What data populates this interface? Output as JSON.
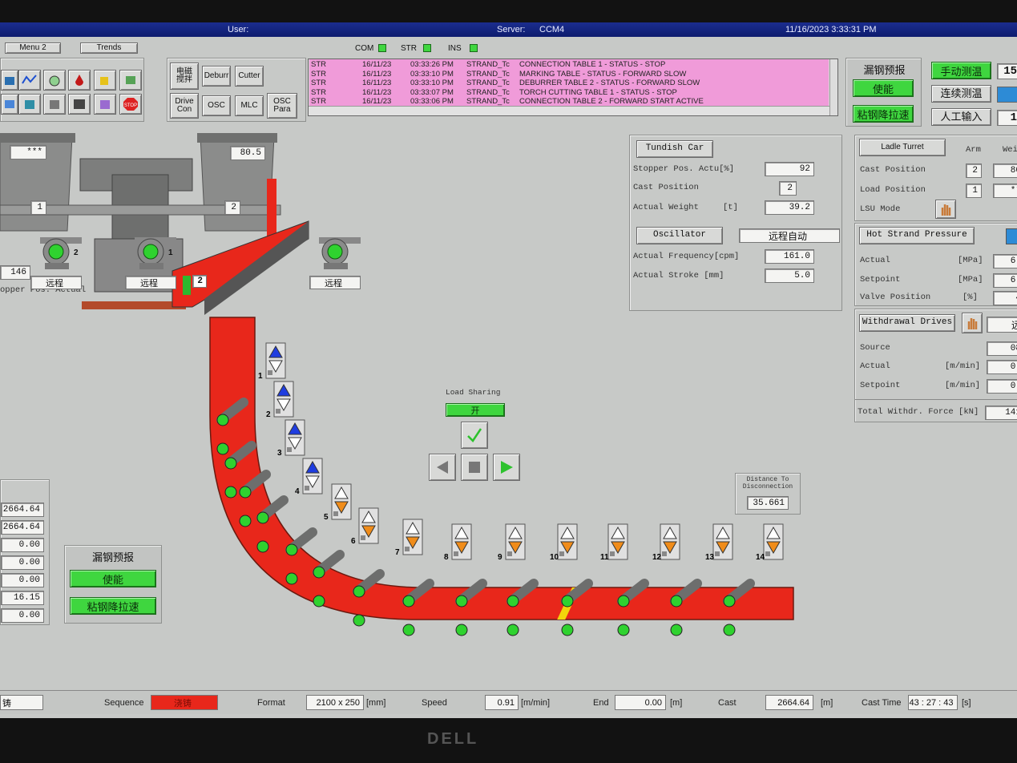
{
  "titlebar": {
    "user_label": "User:",
    "server_label": "Server:",
    "server_value": "CCM4",
    "datetime": "11/16/2023 3:33:31 PM"
  },
  "topnav": {
    "menu2": "Menu 2",
    "trends": "Trends"
  },
  "comm": {
    "com": "COM",
    "str": "STR",
    "ins": "INS"
  },
  "tool_buttons": {
    "em_stir": "电磁\n搅拌",
    "deburr": "Deburr",
    "cutter": "Cutter",
    "drive_con": "Drive\nCon",
    "osc": "OSC",
    "mlc": "MLC",
    "osc_para": "OSC\nPara"
  },
  "alarms": [
    {
      "src": "STR",
      "date": "16/11/23",
      "time": "03:33:26 PM",
      "tag": "STRAND_Tc",
      "msg": "CONNECTION TABLE 1 - STATUS - STOP"
    },
    {
      "src": "STR",
      "date": "16/11/23",
      "time": "03:33:10 PM",
      "tag": "STRAND_Tc",
      "msg": "MARKING TABLE - STATUS - FORWARD SLOW"
    },
    {
      "src": "STR",
      "date": "16/11/23",
      "time": "03:33:10 PM",
      "tag": "STRAND_Tc",
      "msg": "DEBURRER TABLE 2 - STATUS - FORWARD SLOW"
    },
    {
      "src": "STR",
      "date": "16/11/23",
      "time": "03:33:07 PM",
      "tag": "STRAND_Tc",
      "msg": "TORCH CUTTING TABLE 1 - STATUS - STOP"
    },
    {
      "src": "STR",
      "date": "16/11/23",
      "time": "03:33:06 PM",
      "tag": "STRAND_Tc",
      "msg": "CONNECTION TABLE 2 - FORWARD START ACTIVE"
    }
  ],
  "breakout_top": {
    "title": "漏钢预报",
    "enable": "使能",
    "slowdown": "粘钢降拉速"
  },
  "temp_buttons": {
    "manual": "手动测温",
    "continuous": "连续测温",
    "manual_input": "人工输入",
    "v1": "15",
    "v3": "1"
  },
  "ladle": {
    "left_value": "***",
    "right_value": "80.5",
    "left_arm": "1",
    "right_arm": "2",
    "tundish_num": "2",
    "stopper_value": "146",
    "stopper_label": "opper Pos. Actual"
  },
  "fans": [
    {
      "num": "2",
      "label": "远程"
    },
    {
      "num": "1",
      "label": "远程"
    },
    {
      "num": "",
      "label": "远程"
    }
  ],
  "tundish_car": {
    "title": "Tundish Car",
    "stopper_label": "Stopper Pos. Actu",
    "stopper_unit": "[%]",
    "stopper_value": "92",
    "cast_pos_label": "Cast Position",
    "cast_pos_value": "2",
    "weight_label": "Actual Weight",
    "weight_unit": "[t]",
    "weight_value": "39.2"
  },
  "oscillator": {
    "title": "Oscillator",
    "mode": "远程自动",
    "freq_label": "Actual Frequency",
    "freq_unit": "[cpm]",
    "freq_value": "161.0",
    "stroke_label": "Actual Stroke",
    "stroke_unit": "[mm]",
    "stroke_value": "5.0"
  },
  "ladle_turret": {
    "title": "Ladle Turret",
    "arm_hdr": "Arm",
    "weight_hdr": "Wei",
    "cast_pos_label": "Cast Position",
    "cast_pos_arm": "2",
    "cast_pos_val": "80",
    "load_pos_label": "Load Position",
    "load_pos_arm": "1",
    "load_pos_val": "**",
    "lsu_label": "LSU Mode"
  },
  "hot_strand": {
    "title": "Hot Strand Pressure",
    "actual_label": "Actual",
    "actual_unit": "[MPa]",
    "actual_val": "6.",
    "setpoint_label": "Setpoint",
    "setpoint_unit": "[MPa]",
    "setpoint_val": "6.",
    "valve_label": "Valve Position",
    "valve_unit": "[%]",
    "valve_val": "4"
  },
  "withdrawal": {
    "title": "Withdrawal Drives",
    "mode_val": "远",
    "source_label": "Source",
    "source_val": "08",
    "actual_label": "Actual",
    "actual_unit": "[m/min]",
    "actual_val": "0.",
    "setpoint_label": "Setpoint",
    "setpoint_unit": "[m/min]",
    "setpoint_val": "0.",
    "force_label": "Total Withdr. Force",
    "force_unit": "[kN]",
    "force_val": "141"
  },
  "load_sharing": {
    "title": "Load Sharing",
    "state": "开"
  },
  "distance": {
    "title": "Distance To Disconnection",
    "value": "35.661"
  },
  "segments": [
    "1",
    "2",
    "3",
    "4",
    "5",
    "6",
    "7",
    "8",
    "9",
    "10",
    "11",
    "12",
    "13",
    "14"
  ],
  "left_values": [
    "2664.64",
    "2664.64",
    "0.00",
    "0.00",
    "0.00",
    "16.15",
    "0.00"
  ],
  "breakout_bottom": {
    "title": "漏钢预报",
    "enable": "使能",
    "slowdown": "粘钢降拉速"
  },
  "statusbar": {
    "left": "铸",
    "sequence_label": "Sequence",
    "sequence_value": "浇铸",
    "format_label": "Format",
    "format_value": "2100 x 250",
    "format_unit": "[mm]",
    "speed_label": "Speed",
    "speed_value": "0.91",
    "speed_unit": "[m/min]",
    "end_label": "End",
    "end_value": "0.00",
    "end_unit": "[m]",
    "cast_label": "Cast",
    "cast_value": "2664.64",
    "cast_unit": "[m]",
    "casttime_label": "Cast Time",
    "casttime_value": "43 : 27 : 43",
    "casttime_unit": "[s]"
  },
  "bezel_logo": "DELL",
  "colors": {
    "titlebar": "#1b2d8f",
    "alarm_row": "#f09bd9",
    "strand": "#e8271b",
    "green": "#3fd63f",
    "screen_bg": "#c7c9c7"
  }
}
